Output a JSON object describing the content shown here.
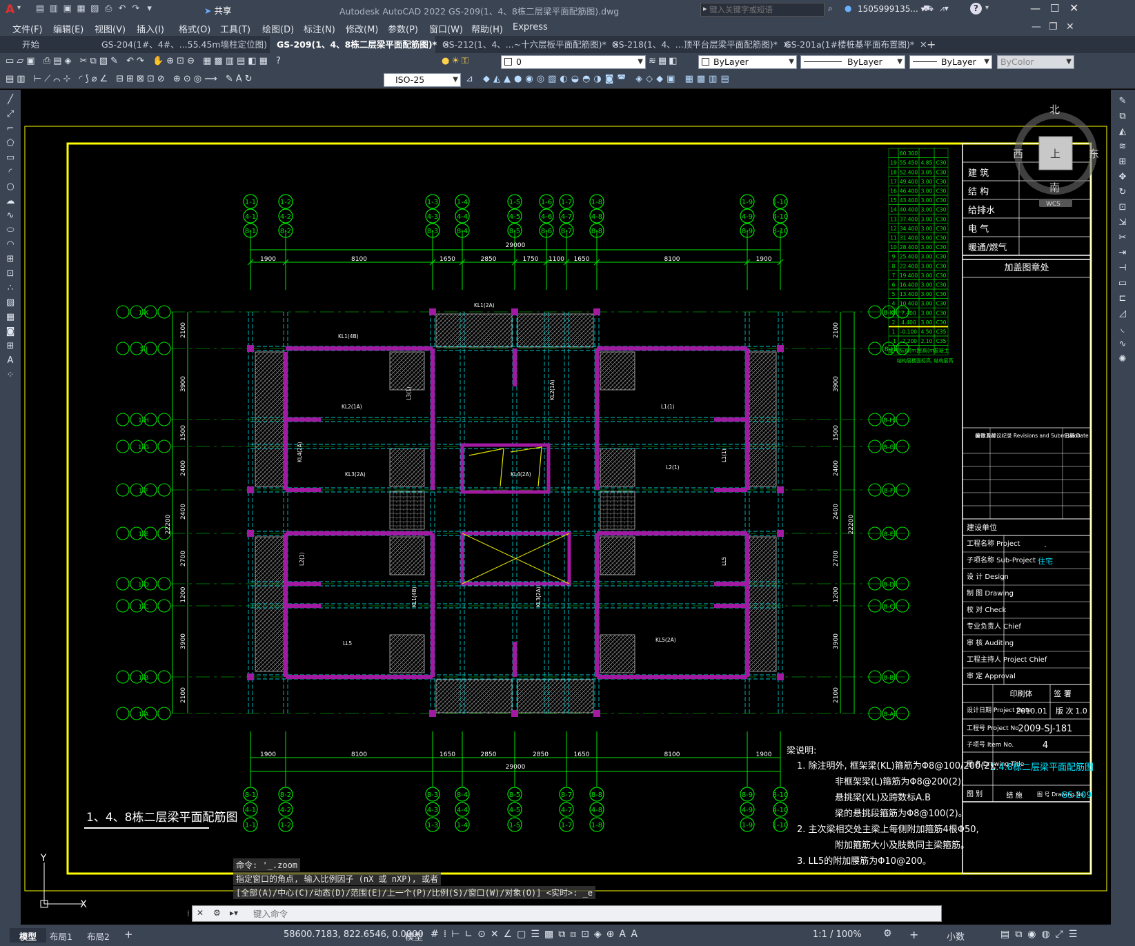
{
  "app": {
    "title": "Autodesk AutoCAD 2022    GS-209(1、4、8栋二层梁平面配筋图).dwg",
    "search_placeholder": "键入关键字或短语",
    "user": "1505999135... ▾",
    "share_label": "共享"
  },
  "menu": [
    "文件(F)",
    "编辑(E)",
    "视图(V)",
    "插入(I)",
    "格式(O)",
    "工具(T)",
    "绘图(D)",
    "标注(N)",
    "修改(M)",
    "参数(P)",
    "窗口(W)",
    "帮助(H)",
    "Express"
  ],
  "tabs": [
    {
      "label": "开始",
      "active": false
    },
    {
      "label": "GS-204(1#、4#、...55.45m墙柱定位图)",
      "active": false
    },
    {
      "label": "GS-209(1、4、8栋二层梁平面配筋图)*",
      "active": true
    },
    {
      "label": "GS-212(1、4、...~十六层板平面配筋图)*",
      "active": false
    },
    {
      "label": "GS-218(1、4、...顶平台层梁平面配筋图)*",
      "active": false
    },
    {
      "label": "GS-201a(1#楼桩基平面布置图)*",
      "active": false
    }
  ],
  "toolbar": {
    "layer_value": "0",
    "color_value": "ByLayer",
    "linetype_value": "ByLayer",
    "lineweight_value": "ByLayer",
    "plotstyle_value": "ByColor",
    "dimstyle_value": "ISO-25"
  },
  "drawing": {
    "title": "1、4、8栋二层梁平面配筋图",
    "top_total": "29000",
    "top_dims": [
      "1900",
      "8100",
      "1650",
      "2850",
      "1750",
      "1100",
      "1650",
      "8100",
      "1900"
    ],
    "bottom_dims": [
      "1900",
      "8100",
      "1650",
      "2850",
      "2850",
      "1650",
      "8100",
      "1900"
    ],
    "left_dims": [
      "2100",
      "3900",
      "1500",
      "2400",
      "2400",
      "2700",
      "1200",
      "3900",
      "2100"
    ],
    "left_total": "22200",
    "axis_top_1": [
      "1-1",
      "1-2",
      "1-3",
      "1-4",
      "1-5",
      "1-6",
      "1-7",
      "1-8",
      "1-9",
      "1-10"
    ],
    "axis_top_2": [
      "4-1",
      "4-2",
      "4-3",
      "4-4",
      "4-5",
      "4-6",
      "4-7",
      "4-8",
      "4-9",
      "4-10"
    ],
    "axis_top_3": [
      "8-1",
      "8-2",
      "8-3",
      "8-4",
      "8-5",
      "8-6",
      "8-7",
      "8-8",
      "8-9",
      "8-10"
    ],
    "axis_bottom_1": [
      "8-1",
      "8-2",
      "8-3",
      "8-4",
      "8-5",
      "8-7",
      "8-8",
      "8-9",
      "8-10"
    ],
    "axis_bottom_2": [
      "4-1",
      "4-2",
      "4-3",
      "4-4",
      "4-5",
      "4-7",
      "4-8",
      "4-9",
      "4-10"
    ],
    "axis_bottom_3": [
      "1-1",
      "1-2",
      "1-3",
      "1-4",
      "1-5",
      "1-7",
      "1-8",
      "1-9",
      "1-10"
    ],
    "axis_left": [
      "1-K",
      "1-J",
      "1-H",
      "1-G",
      "1-F",
      "1-E",
      "1-D",
      "1-C",
      "1-B",
      "1-A"
    ],
    "axis_right": [
      "8-K",
      "8-J",
      "8-H",
      "8-G",
      "8-F",
      "8-E",
      "8-D",
      "8-C",
      "8-B",
      "8-A"
    ],
    "notes_title": "梁说明:",
    "notes": [
      "1. 除注明外, 框架梁(KL)箍筋为Φ8@100/200(2);",
      "非框架梁(L)箍筋为Φ8@200(2);",
      "悬挑梁(XL)及跨数标A.B",
      "梁的悬挑段箍筋为Φ8@100(2)。",
      "2. 主次梁相交处主梁上每侧附加箍筋4根Φ50,",
      "附加箍筋大小及肢数同主梁箍筋。",
      "3. LL5的附加腰筋为Φ10@200。"
    ],
    "beam_labels": [
      "KL1(4B)",
      "KL2(1A)",
      "KL3(2A)",
      "KL4(2A)",
      "L1(1)",
      "L2(1)",
      "LL5",
      "KL5(2A)",
      "KL1(2A)",
      "L3(1)"
    ],
    "floor_table": [
      [
        "",
        "60.300",
        "",
        ""
      ],
      [
        "19",
        "55.450",
        "4.85",
        "C30"
      ],
      [
        "18",
        "52.400",
        "3.05",
        "C30"
      ],
      [
        "17",
        "49.400",
        "3.00",
        "C30"
      ],
      [
        "16",
        "46.400",
        "3.00",
        "C30"
      ],
      [
        "15",
        "43.400",
        "3.00",
        "C30"
      ],
      [
        "14",
        "40.400",
        "3.00",
        "C30"
      ],
      [
        "13",
        "37.400",
        "3.00",
        "C30"
      ],
      [
        "12",
        "34.400",
        "3.00",
        "C30"
      ],
      [
        "11",
        "31.400",
        "3.00",
        "C30"
      ],
      [
        "10",
        "28.400",
        "3.00",
        "C30"
      ],
      [
        "9",
        "25.400",
        "3.00",
        "C30"
      ],
      [
        "8",
        "22.400",
        "3.00",
        "C30"
      ],
      [
        "7",
        "19.400",
        "3.00",
        "C30"
      ],
      [
        "6",
        "16.400",
        "3.00",
        "C30"
      ],
      [
        "5",
        "13.400",
        "3.00",
        "C30"
      ],
      [
        "4",
        "10.400",
        "3.00",
        "C30"
      ],
      [
        "3",
        "7.400",
        "3.00",
        "C30"
      ],
      [
        "2",
        "4.400",
        "3.00",
        "C30"
      ],
      [
        "1",
        "-0.100",
        "4.50",
        "C35"
      ],
      [
        "-1",
        "-2.200",
        "2.10",
        "C35"
      ],
      [
        "层号",
        "标高(m)",
        "层高(m)",
        "混凝土"
      ]
    ],
    "floor_table_note": "结构层楼面标高, 结构层高"
  },
  "titleblock": {
    "disciplines": [
      "建  筑",
      "结  构",
      "给排水",
      "电  气",
      "暖通/燃气"
    ],
    "stamp": "加盖图章处",
    "revision_header": [
      "编号 No.",
      "修改及建议纪录 Revisions and Submission",
      "日期 Date"
    ],
    "client_label": "建设单位",
    "fields": [
      [
        "工程名称 Project",
        "."
      ],
      [
        "子项名称 Sub-Project",
        "住宅"
      ],
      [
        "设  计 Design",
        ""
      ],
      [
        "制  图 Drawing",
        ""
      ],
      [
        "校  对 Check",
        ""
      ],
      [
        "专业负责人 Chief",
        ""
      ],
      [
        "审  核 Auditing",
        ""
      ],
      [
        "工程主持人 Project Chief",
        ""
      ],
      [
        "审  定 Approval",
        ""
      ]
    ],
    "print_label": "印刷体",
    "sign_label": "签  署",
    "design_date_label": "设计日期 Project Date",
    "design_date": "2010.01",
    "version_label": "版 次",
    "version": "1.0",
    "project_no_label": "工程号 Project No.",
    "project_no": "2009-SJ-181",
    "item_no_label": "子项号 Item No.",
    "item_no": "4",
    "drawing_title_label": "图 名 Drawing Title",
    "drawing_title": "1.4.8栋二层梁平面配筋图",
    "drawing_type_label": "图 别",
    "drawing_type": "结 施",
    "drawing_no_label": "图 号 Drawing No.",
    "drawing_no": "GS-209"
  },
  "viewcube": {
    "north": "北",
    "south": "南",
    "east": "东",
    "west": "西",
    "top": "上",
    "wcs": "WCS"
  },
  "command": {
    "line1": "命令: '_.zoom",
    "line2": "指定窗口的角点, 输入比例因子 (nX 或 nXP), 或者",
    "line3": "[全部(A)/中心(C)/动态(D)/范围(E)/上一个(P)/比例(S)/窗口(W)/对象(O)] <实时>: _e",
    "input_placeholder": "键入命令"
  },
  "status": {
    "layout_tabs": [
      "模型",
      "布局1",
      "布局2"
    ],
    "coords": "58600.7183, 822.6546, 0.0000",
    "model": "模型",
    "scale": "1:1 / 100%",
    "units": "小数"
  },
  "colors": {
    "column": "#a11aa1",
    "axis": "#00e600",
    "beam": "#00c8c8",
    "border": "#ffff00",
    "text": "#ffffff",
    "hatch": "#9a9a9a"
  }
}
